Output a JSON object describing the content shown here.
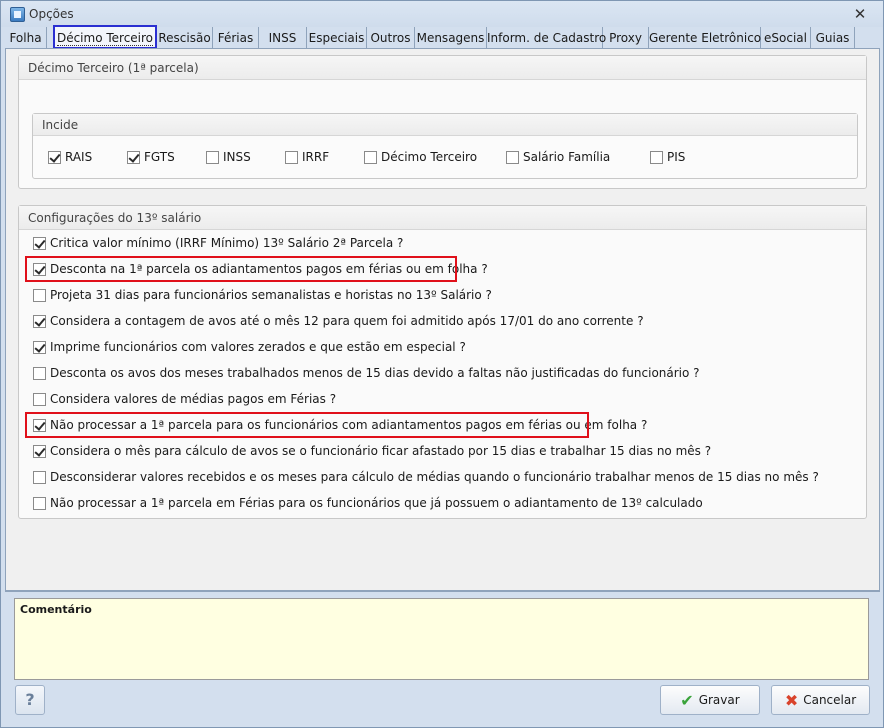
{
  "window": {
    "title": "Opções",
    "close_icon": "close-icon"
  },
  "tabs": [
    {
      "label": "Folha"
    },
    {
      "label": "Décimo Terceiro",
      "active": true
    },
    {
      "label": "Rescisão"
    },
    {
      "label": "Férias"
    },
    {
      "label": "INSS"
    },
    {
      "label": "Especiais"
    },
    {
      "label": "Outros"
    },
    {
      "label": "Mensagens"
    },
    {
      "label": "Inform. de Cadastro"
    },
    {
      "label": "Proxy"
    },
    {
      "label": "Gerente Eletrônico"
    },
    {
      "label": "eSocial"
    },
    {
      "label": "Guias"
    }
  ],
  "primeira_parcela": {
    "title": "Décimo Terceiro (1ª parcela)",
    "incide": {
      "title": "Incide",
      "items": [
        {
          "label": "RAIS",
          "checked": true
        },
        {
          "label": "FGTS",
          "checked": true
        },
        {
          "label": "INSS",
          "checked": false
        },
        {
          "label": "IRRF",
          "checked": false
        },
        {
          "label": "Décimo Terceiro",
          "checked": false
        },
        {
          "label": "Salário Família",
          "checked": false
        },
        {
          "label": "PIS",
          "checked": false
        }
      ]
    }
  },
  "configuracoes": {
    "title": "Configurações do 13º salário",
    "items": [
      {
        "label": "Critica valor mínimo (IRRF Mínimo) 13º Salário 2ª Parcela ?",
        "checked": true,
        "highlighted": false
      },
      {
        "label": "Desconta na 1ª parcela os adiantamentos pagos em férias ou em folha ?",
        "checked": true,
        "highlighted": true
      },
      {
        "label": "Projeta 31 dias para funcionários semanalistas e horistas no 13º Salário ?",
        "checked": false,
        "highlighted": false
      },
      {
        "label": "Considera a contagem de avos até o mês 12 para quem foi admitido após 17/01 do ano corrente ?",
        "checked": true,
        "highlighted": false
      },
      {
        "label": "Imprime funcionários com valores zerados e que estão em especial ?",
        "checked": true,
        "highlighted": false
      },
      {
        "label": "Desconta os avos dos meses trabalhados menos de 15 dias devido a faltas não justificadas do funcionário ?",
        "checked": false,
        "highlighted": false
      },
      {
        "label": "Considera valores de médias pagos em Férias ?",
        "checked": false,
        "highlighted": false
      },
      {
        "label": "Não processar a 1ª parcela para os funcionários com adiantamentos pagos em férias ou em folha ?",
        "checked": true,
        "highlighted": true
      },
      {
        "label": "Considera o mês para cálculo de avos se o funcionário ficar afastado por 15 dias e trabalhar 15 dias no mês ?",
        "checked": true,
        "highlighted": false
      },
      {
        "label": "Desconsiderar valores recebidos e os meses para cálculo de médias quando o funcionário trabalhar menos de 15 dias no mês ?",
        "checked": false,
        "highlighted": false
      },
      {
        "label": "Não processar a 1ª parcela em Férias para os funcionários que já possuem o adiantamento de 13º calculado",
        "checked": false,
        "highlighted": false
      }
    ]
  },
  "comment": {
    "label": "Comentário"
  },
  "buttons": {
    "help": "?",
    "save": "Gravar",
    "cancel": "Cancelar"
  },
  "colors": {
    "highlight": "#e0101a",
    "active_tab_border": "#2a2fd1",
    "comment_bg": "#ffffe1"
  }
}
